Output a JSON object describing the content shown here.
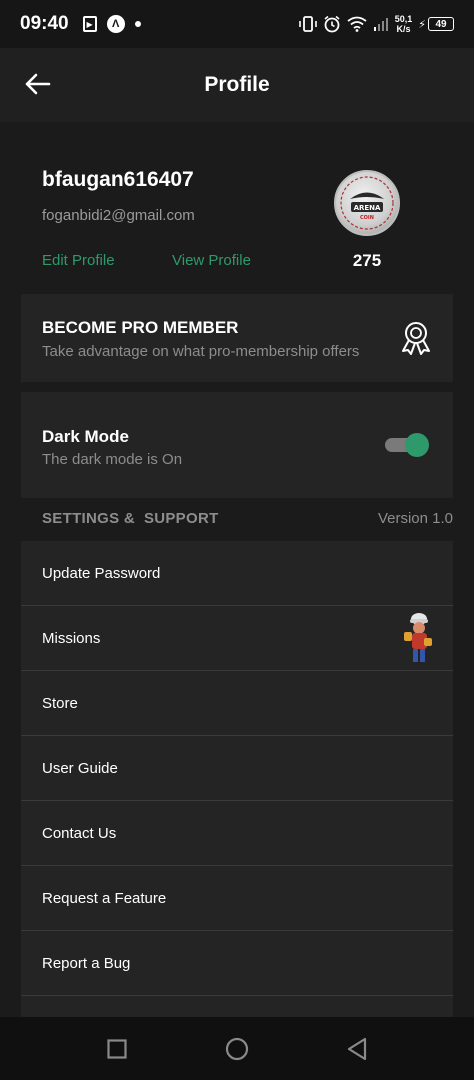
{
  "status_bar": {
    "time": "09:40",
    "net_speed_value": "50,1",
    "net_speed_unit": "K/s",
    "battery": "49"
  },
  "app_bar": {
    "title": "Profile"
  },
  "profile": {
    "username": "bfaugan616407",
    "email": "foganbidi2@gmail.com",
    "edit_label": "Edit Profile",
    "view_label": "View Profile",
    "coins": "275",
    "avatar_text_top": "ARENA",
    "avatar_text_bottom": "COIN"
  },
  "pro_card": {
    "title": "BECOME PRO MEMBER",
    "subtitle": "Take advantage on what pro-membership offers"
  },
  "dark_mode": {
    "title": "Dark Mode",
    "subtitle": "The dark mode is On",
    "enabled": true
  },
  "settings": {
    "section_title": "SETTINGS &  SUPPORT",
    "version": "Version 1.0",
    "items": [
      {
        "label": "Update Password"
      },
      {
        "label": "Missions"
      },
      {
        "label": "Store"
      },
      {
        "label": "User Guide"
      },
      {
        "label": "Contact Us"
      },
      {
        "label": "Request a Feature"
      },
      {
        "label": "Report a Bug"
      },
      {
        "label": ""
      }
    ]
  },
  "colors": {
    "accent": "#2e9a6c",
    "background": "#1b1b1b",
    "card": "#242424",
    "app_bar": "#202020"
  }
}
